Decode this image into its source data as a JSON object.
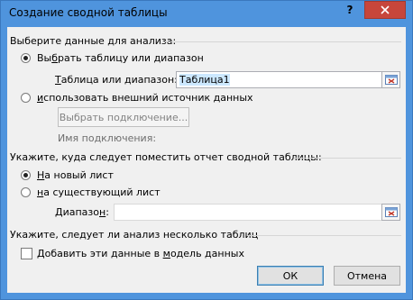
{
  "window": {
    "title": "Создание сводной таблицы",
    "help_label": "?",
    "colors": {
      "frame": "#4f94dd",
      "close": "#c7463b",
      "body": "#f0f0f0"
    }
  },
  "data_section": {
    "heading": "Выберите данные для анализа:",
    "option_table": {
      "label_pre": "Вы",
      "label_u": "б",
      "label_post": "рать таблицу или диапазон",
      "checked": true
    },
    "range_label_pre": "",
    "range_label_u": "Т",
    "range_label_post": "аблица или диапазон:",
    "range_value": "Таблица1",
    "option_external": {
      "label_pre": "",
      "label_u": "и",
      "label_post": "спользовать внешний источник данных",
      "checked": false
    },
    "choose_connection_button": "Выбрать подключение...",
    "connection_name_label": "Имя подключения:"
  },
  "location_section": {
    "heading": "Укажите, куда следует поместить отчет сводной таблицы:",
    "option_new": {
      "label_pre": "",
      "label_u": "Н",
      "label_post": "а новый лист",
      "checked": true
    },
    "option_existing": {
      "label_pre": "",
      "label_u": "н",
      "label_post": "а существующий лист",
      "checked": false
    },
    "range_label_pre": "Диапазо",
    "range_label_u": "н",
    "range_label_post": ":",
    "range_value": ""
  },
  "multi_section": {
    "heading": "Укажите, следует ли анализ несколько таблиц",
    "checkbox_label_pre": "Добавить эти данные в ",
    "checkbox_label_u": "м",
    "checkbox_label_post": "одель данных",
    "checked": false
  },
  "footer": {
    "ok_label": "ОК",
    "cancel_label": "Отмена"
  }
}
